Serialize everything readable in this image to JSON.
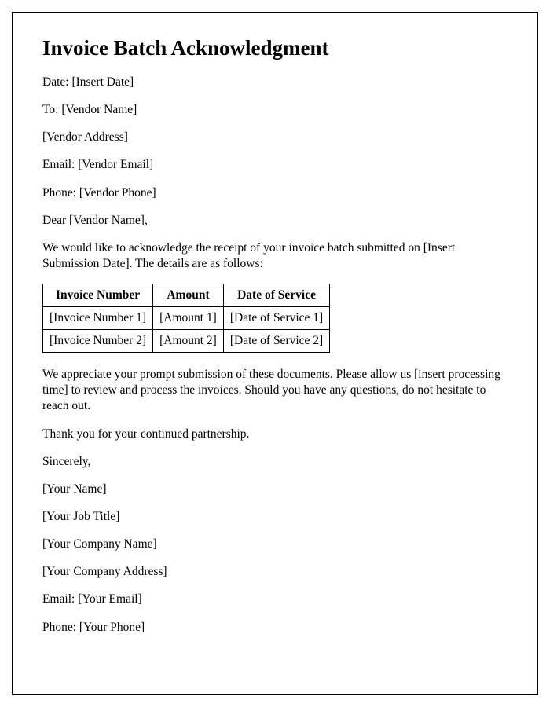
{
  "title": "Invoice Batch Acknowledgment",
  "header": {
    "date": "Date: [Insert Date]",
    "to": "To: [Vendor Name]",
    "address": "[Vendor Address]",
    "email": "Email: [Vendor Email]",
    "phone": "Phone: [Vendor Phone]"
  },
  "salutation": "Dear [Vendor Name],",
  "intro": "We would like to acknowledge the receipt of your invoice batch submitted on [Insert Submission Date]. The details are as follows:",
  "table": {
    "headers": {
      "invoice_number": "Invoice Number",
      "amount": "Amount",
      "date_of_service": "Date of Service"
    },
    "rows": [
      {
        "invoice_number": "[Invoice Number 1]",
        "amount": "[Amount 1]",
        "date_of_service": "[Date of Service 1]"
      },
      {
        "invoice_number": "[Invoice Number 2]",
        "amount": "[Amount 2]",
        "date_of_service": "[Date of Service 2]"
      }
    ]
  },
  "body1": "We appreciate your prompt submission of these documents. Please allow us [insert processing time] to review and process the invoices. Should you have any questions, do not hesitate to reach out.",
  "body2": "Thank you for your continued partnership.",
  "closing": "Sincerely,",
  "signature": {
    "name": "[Your Name]",
    "job_title": "[Your Job Title]",
    "company_name": "[Your Company Name]",
    "company_address": "[Your Company Address]",
    "email": "Email: [Your Email]",
    "phone": "Phone: [Your Phone]"
  }
}
